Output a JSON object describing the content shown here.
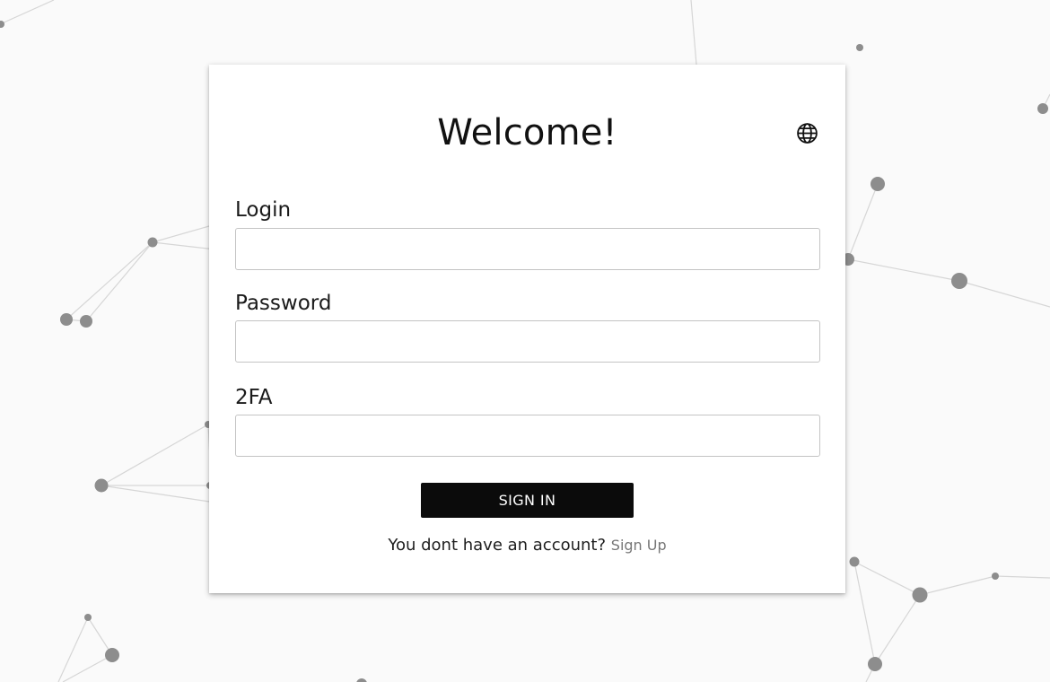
{
  "login_card": {
    "title": "Welcome!",
    "language_icon": "globe-icon",
    "fields": [
      {
        "label": "Login",
        "value": "",
        "placeholder": ""
      },
      {
        "label": "Password",
        "value": "",
        "placeholder": ""
      },
      {
        "label": "2FA",
        "value": "",
        "placeholder": ""
      }
    ],
    "submit_label": "SIGN IN",
    "signup_prompt": "You dont have an account?",
    "signup_link": "Sign Up"
  },
  "theme": {
    "button_color": "#0b0b0b",
    "link_color": "#777777",
    "background_color": "#fafafa"
  }
}
